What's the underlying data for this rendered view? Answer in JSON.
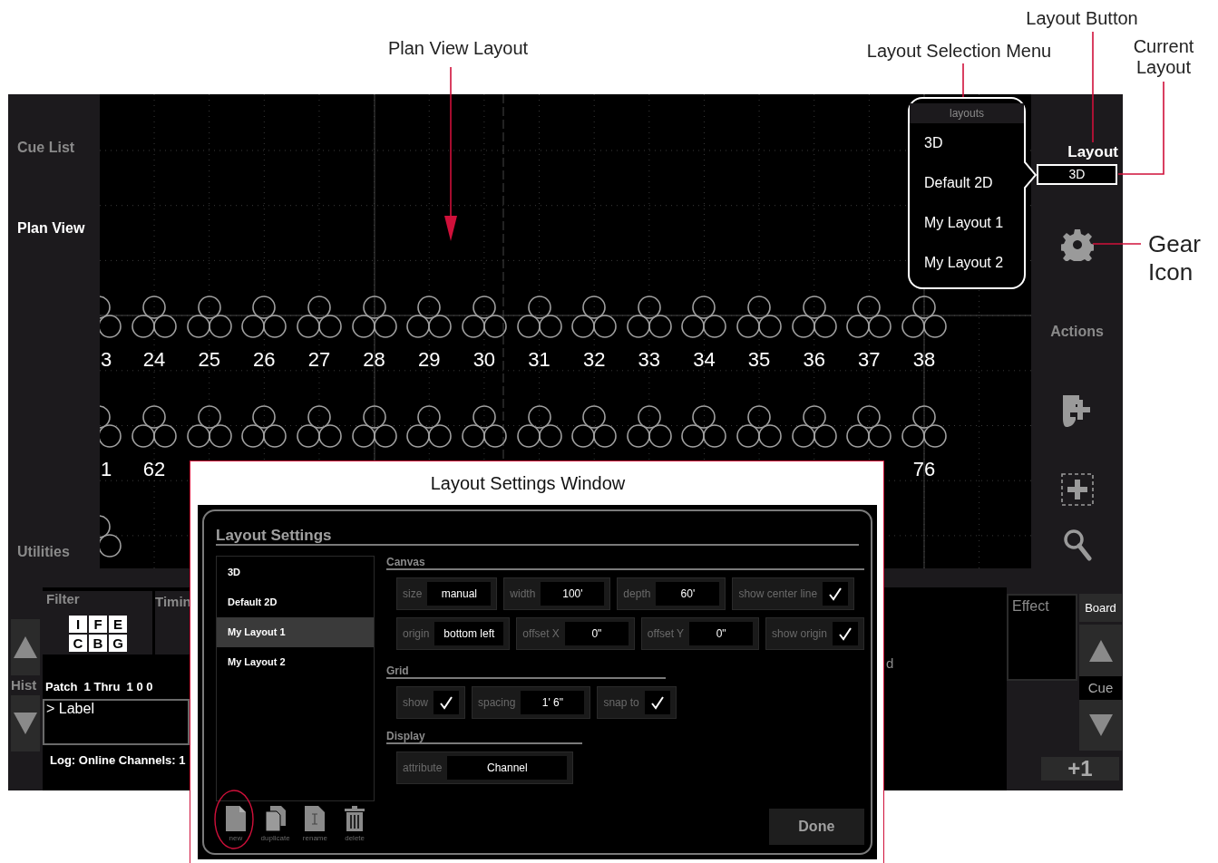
{
  "annotations": [
    {
      "text": "Plan View Layout"
    },
    {
      "text": "Layout Selection Menu"
    },
    {
      "text": "Layout Button"
    },
    {
      "text": "Current Layout"
    },
    {
      "text": "Gear Icon"
    },
    {
      "text": "Layout Settings Window"
    }
  ],
  "sidebar": {
    "items": [
      {
        "label": "Cue List",
        "selected": false
      },
      {
        "label": "Plan View",
        "selected": true
      },
      {
        "label": "Utilities",
        "selected": false
      }
    ]
  },
  "plan_view": {
    "rows": [
      {
        "fixtures": [
          {
            "kind": "labeled",
            "label": "3"
          },
          {
            "kind": "labeled",
            "label": "24"
          },
          {
            "kind": "labeled",
            "label": "25"
          },
          {
            "kind": "labeled",
            "label": "26"
          },
          {
            "kind": "labeled",
            "label": "27"
          },
          {
            "kind": "labeled",
            "label": "28"
          },
          {
            "kind": "labeled",
            "label": "29"
          },
          {
            "kind": "labeled",
            "label": "30"
          },
          {
            "kind": "labeled",
            "label": "31"
          },
          {
            "kind": "labeled",
            "label": "32"
          },
          {
            "kind": "labeled",
            "label": "33"
          },
          {
            "kind": "labeled",
            "label": "34"
          },
          {
            "kind": "labeled",
            "label": "35"
          },
          {
            "kind": "labeled",
            "label": "36"
          },
          {
            "kind": "labeled",
            "label": "37"
          },
          {
            "kind": "labeled",
            "label": "38"
          }
        ]
      },
      {
        "fixtures": [
          {
            "kind": "labeled",
            "label": "1"
          },
          {
            "kind": "labeled",
            "label": "62"
          },
          {
            "kind": "unlabeled"
          },
          {
            "kind": "unlabeled"
          },
          {
            "kind": "unlabeled"
          },
          {
            "kind": "unlabeled"
          },
          {
            "kind": "unlabeled"
          },
          {
            "kind": "unlabeled"
          },
          {
            "kind": "unlabeled"
          },
          {
            "kind": "unlabeled"
          },
          {
            "kind": "unlabeled"
          },
          {
            "kind": "unlabeled"
          },
          {
            "kind": "unlabeled"
          },
          {
            "kind": "unlabeled"
          },
          {
            "kind": "unlabeled"
          },
          {
            "kind": "labeled",
            "label": "76"
          }
        ]
      },
      {
        "fixtures": [
          {
            "kind": "unlabeled"
          }
        ]
      }
    ]
  },
  "layout_menu": {
    "title": "layouts",
    "items": [
      {
        "label": "3D"
      },
      {
        "label": "Default 2D"
      },
      {
        "label": "My Layout 1"
      },
      {
        "label": "My Layout 2"
      }
    ]
  },
  "right_sidebar": {
    "layout_label": "Layout",
    "current_layout": "3D",
    "actions_label": "Actions"
  },
  "command_panel": {
    "hist_label": "Hist",
    "filter": {
      "title": "Filter",
      "keys": [
        "I",
        "F",
        "E",
        "C",
        "B",
        "G"
      ]
    },
    "timing_title": "Timin",
    "patch_text": "Patch  1 Thru  1 0 0",
    "command_line": "> Label",
    "log": "Log: Online Channels: 1",
    "cut_off_text": "d",
    "effect_title": "Effect",
    "board_button": "Board",
    "cue_label": "Cue",
    "step_button": "+1"
  },
  "settings_dialog": {
    "title": "Layout Settings",
    "layouts": [
      {
        "label": "3D",
        "selected": false
      },
      {
        "label": "Default 2D",
        "selected": false
      },
      {
        "label": "My Layout 1",
        "selected": true
      },
      {
        "label": "My Layout 2",
        "selected": false
      }
    ],
    "sections": [
      {
        "title": "Canvas",
        "rows": [
          [
            {
              "kind": "field",
              "label": "size",
              "value": "manual"
            },
            {
              "kind": "field",
              "label": "width",
              "value": "100'"
            },
            {
              "kind": "field",
              "label": "depth",
              "value": "60'"
            },
            {
              "kind": "check",
              "label": "show center line",
              "checked": true
            }
          ],
          [
            {
              "kind": "field",
              "label": "origin",
              "value": "bottom left"
            },
            {
              "kind": "field",
              "label": "offset X",
              "value": "0\""
            },
            {
              "kind": "field",
              "label": "offset Y",
              "value": "0\""
            },
            {
              "kind": "check",
              "label": "show origin",
              "checked": true
            }
          ]
        ]
      },
      {
        "title": "Grid",
        "rows": [
          [
            {
              "kind": "check",
              "label": "show",
              "checked": true
            },
            {
              "kind": "field",
              "label": "spacing",
              "value": "1' 6\""
            },
            {
              "kind": "check",
              "label": "snap to",
              "checked": true
            }
          ]
        ]
      },
      {
        "title": "Display",
        "rows": [
          [
            {
              "kind": "field",
              "label": "attribute",
              "value": "Channel"
            }
          ]
        ]
      }
    ],
    "toolbar": [
      {
        "kind": "page",
        "label": "new",
        "circled": true
      },
      {
        "kind": "pages",
        "label": "duplicate",
        "circled": false
      },
      {
        "kind": "rename",
        "label": "rename",
        "circled": false
      },
      {
        "kind": "trash",
        "label": "delete",
        "circled": false
      }
    ],
    "done_button": "Done"
  }
}
